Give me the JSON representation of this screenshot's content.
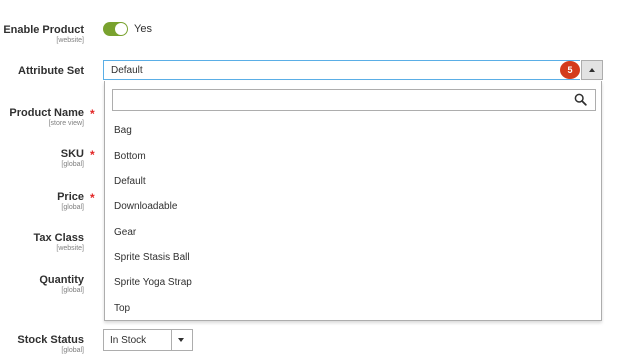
{
  "fields": {
    "enable_product": {
      "label": "Enable Product",
      "scope": "[website]",
      "value": "Yes",
      "enabled": true
    },
    "attribute_set": {
      "label": "Attribute Set",
      "value": "Default"
    },
    "product_name": {
      "label": "Product Name",
      "scope": "[store view]",
      "required": "*"
    },
    "sku": {
      "label": "SKU",
      "scope": "[global]",
      "required": "*"
    },
    "price": {
      "label": "Price",
      "scope": "[global]",
      "required": "*"
    },
    "tax_class": {
      "label": "Tax Class",
      "scope": "[website]"
    },
    "quantity": {
      "label": "Quantity",
      "scope": "[global]"
    },
    "stock_status": {
      "label": "Stock Status",
      "scope": "[global]",
      "value": "In Stock"
    }
  },
  "step_badge": "5",
  "dropdown": {
    "search_value": "",
    "options": [
      "Bag",
      "Bottom",
      "Default",
      "Downloadable",
      "Gear",
      "Sprite Stasis Ball",
      "Sprite Yoga Strap",
      "Top"
    ]
  },
  "icons": {
    "search": "search-icon",
    "toggle_arrow": "triangle-up-icon",
    "stock_arrow": "triangle-down-icon"
  },
  "colors": {
    "toggle_on": "#79a22e",
    "focus_border": "#5aaee6",
    "badge": "#d43b1c",
    "required": "#e22626"
  }
}
